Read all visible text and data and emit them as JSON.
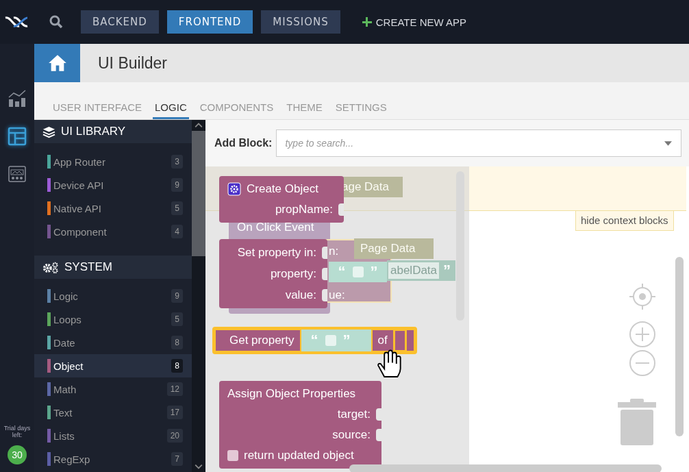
{
  "topbar": {
    "nav": [
      {
        "label": "BACKEND",
        "selected": false
      },
      {
        "label": "FRONTEND",
        "selected": true
      },
      {
        "label": "MISSIONS",
        "selected": false
      }
    ],
    "create_button": "CREATE NEW APP"
  },
  "rail": {
    "items": [
      {
        "kind": "chart",
        "selected": false
      },
      {
        "kind": "layout",
        "selected": true
      },
      {
        "kind": "screen",
        "selected": false
      }
    ],
    "trial_label": "Trial days left:",
    "trial_days": "30"
  },
  "header": {
    "title": "UI Builder"
  },
  "tabs": [
    {
      "label": "USER INTERFACE",
      "selected": false
    },
    {
      "label": "LOGIC",
      "selected": true
    },
    {
      "label": "COMPONENTS",
      "selected": false
    },
    {
      "label": "THEME",
      "selected": false
    },
    {
      "label": "SETTINGS",
      "selected": false
    }
  ],
  "library": [
    {
      "title": "UI LIBRARY",
      "kind": "layers",
      "items": [
        {
          "label": "App Router",
          "count": "3",
          "color": "#4aa59a",
          "selected": false
        },
        {
          "label": "Device API",
          "count": "9",
          "color": "#9c5cd6",
          "selected": false
        },
        {
          "label": "Native API",
          "count": "5",
          "color": "#e07020",
          "selected": false
        },
        {
          "label": "Component",
          "count": "4",
          "color": "#74558f",
          "selected": false
        }
      ]
    },
    {
      "title": "SYSTEM",
      "kind": "gears",
      "items": [
        {
          "label": "Logic",
          "count": "9",
          "color": "#5b80a5",
          "selected": false
        },
        {
          "label": "Loops",
          "count": "5",
          "color": "#5ba55b",
          "selected": false
        },
        {
          "label": "Date",
          "count": "8",
          "color": "#5ba5a5",
          "selected": false
        },
        {
          "label": "Object",
          "count": "8",
          "color": "#a55b80",
          "selected": true
        },
        {
          "label": "Math",
          "count": "12",
          "color": "#5b67a5",
          "selected": false
        },
        {
          "label": "Text",
          "count": "17",
          "color": "#5ba58c",
          "selected": false
        },
        {
          "label": "Lists",
          "count": "20",
          "color": "#745ba5",
          "selected": false
        },
        {
          "label": "RegExp",
          "count": "7",
          "color": "#5b5ea5",
          "selected": false
        }
      ]
    }
  ],
  "add_block": {
    "label": "Add Block:",
    "placeholder": "type to search..."
  },
  "context_blocks": [
    {
      "kind": "data",
      "text": "age Data"
    },
    {
      "kind": "event",
      "text": "On Click Event"
    },
    {
      "kind": "setter",
      "text": "n:",
      "text_2": "ue:"
    },
    {
      "kind": "data",
      "text": "Page Data"
    },
    {
      "kind": "string",
      "text": "abelData",
      "close": "”"
    }
  ],
  "blocks": [
    {
      "kind": "create",
      "title": "Create Object",
      "inputs": [
        "propName:"
      ],
      "selected": false
    },
    {
      "kind": "set",
      "inputs": [
        "Set property in:",
        "property:",
        "value:"
      ],
      "quote_open": "“",
      "quote_close": "”",
      "selected": false
    },
    {
      "kind": "get",
      "title": "Get property",
      "quote_open": "“",
      "quote_close": "”",
      "suffix": "of",
      "selected": true
    },
    {
      "kind": "assign",
      "title": "Assign Object Properties",
      "inputs": [
        "target:",
        "source:"
      ],
      "option": {
        "label": "return updated object",
        "checked": false
      },
      "selected": false
    }
  ],
  "hide_context": "hide context blocks"
}
